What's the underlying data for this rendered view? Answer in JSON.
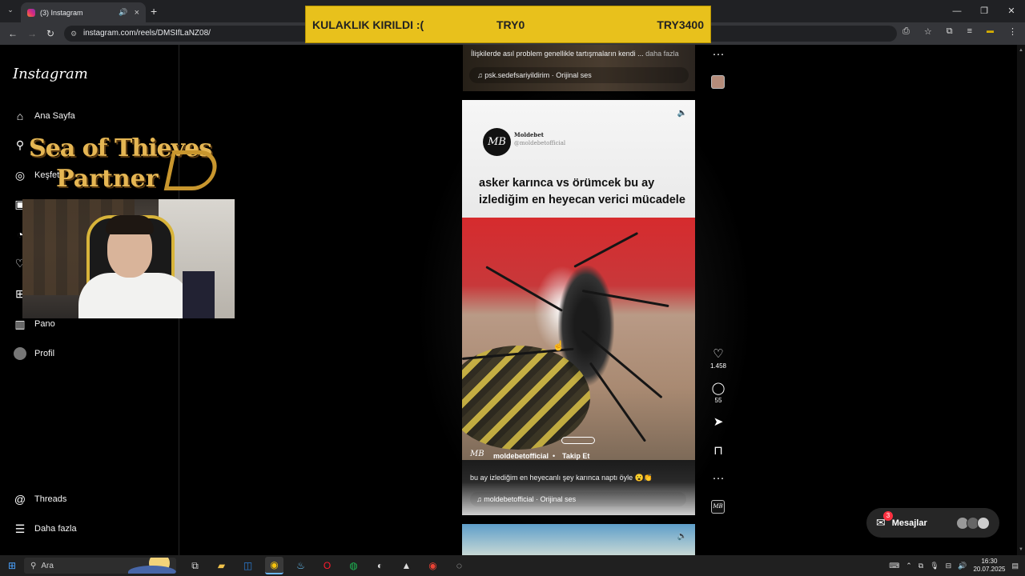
{
  "browser": {
    "tab_title": "(3) Instagram",
    "url": "instagram.com/reels/DMSIfLaNZ08/",
    "new_tab": "+",
    "window_controls": [
      "—",
      "❐",
      "✕"
    ]
  },
  "donation": {
    "message": "KULAKLIK KIRILDI :(",
    "amount_left": "TRY0",
    "amount_right": "TRY3400"
  },
  "sidebar": {
    "logo": "Instagram",
    "items": [
      {
        "label": "Ana Sayfa",
        "icon": "home-icon"
      },
      {
        "label": "",
        "icon": "search-icon"
      },
      {
        "label": "Keşfet",
        "icon": "compass-icon"
      },
      {
        "label": "",
        "icon": "reels-icon"
      },
      {
        "label": "",
        "icon": "messenger-icon"
      },
      {
        "label": "",
        "icon": "heart-icon"
      },
      {
        "label": "",
        "icon": "create-icon"
      },
      {
        "label": "Pano",
        "icon": "dashboard-icon"
      },
      {
        "label": "Profil",
        "icon": "avatar"
      },
      {
        "label": "Threads",
        "icon": "threads-icon"
      },
      {
        "label": "Daha fazla",
        "icon": "menu-icon"
      }
    ]
  },
  "overlay": {
    "line1": "Sea of Thieves",
    "line2": "Partner"
  },
  "prev_reel": {
    "caption": "İlişkilerde asıl problem genellikle tartışmaların kendi ...",
    "more": "daha fazla",
    "audio": "psk.sedefsariyildirim · Orijinal ses"
  },
  "reel": {
    "account_name": "Moldebet",
    "account_handle": "@moldebetofficial",
    "avatar_text": "MB",
    "headline": "asker karınca vs örümcek bu ay izlediğim en heyecan verici mücadele",
    "username": "moldebetofficial",
    "dot": "•",
    "follow": "Takip Et",
    "caption": "bu ay izlediğim en heyecanlı şey karınca naptı öyle 😮👏",
    "audio": "moldebetofficial · Orijinal ses"
  },
  "actions": {
    "likes": "1.458",
    "comments": "55"
  },
  "messages": {
    "label": "Mesajlar",
    "badge": "3"
  },
  "taskbar": {
    "search_placeholder": "Ara",
    "time": "16:30",
    "date": "20.07.2025"
  }
}
